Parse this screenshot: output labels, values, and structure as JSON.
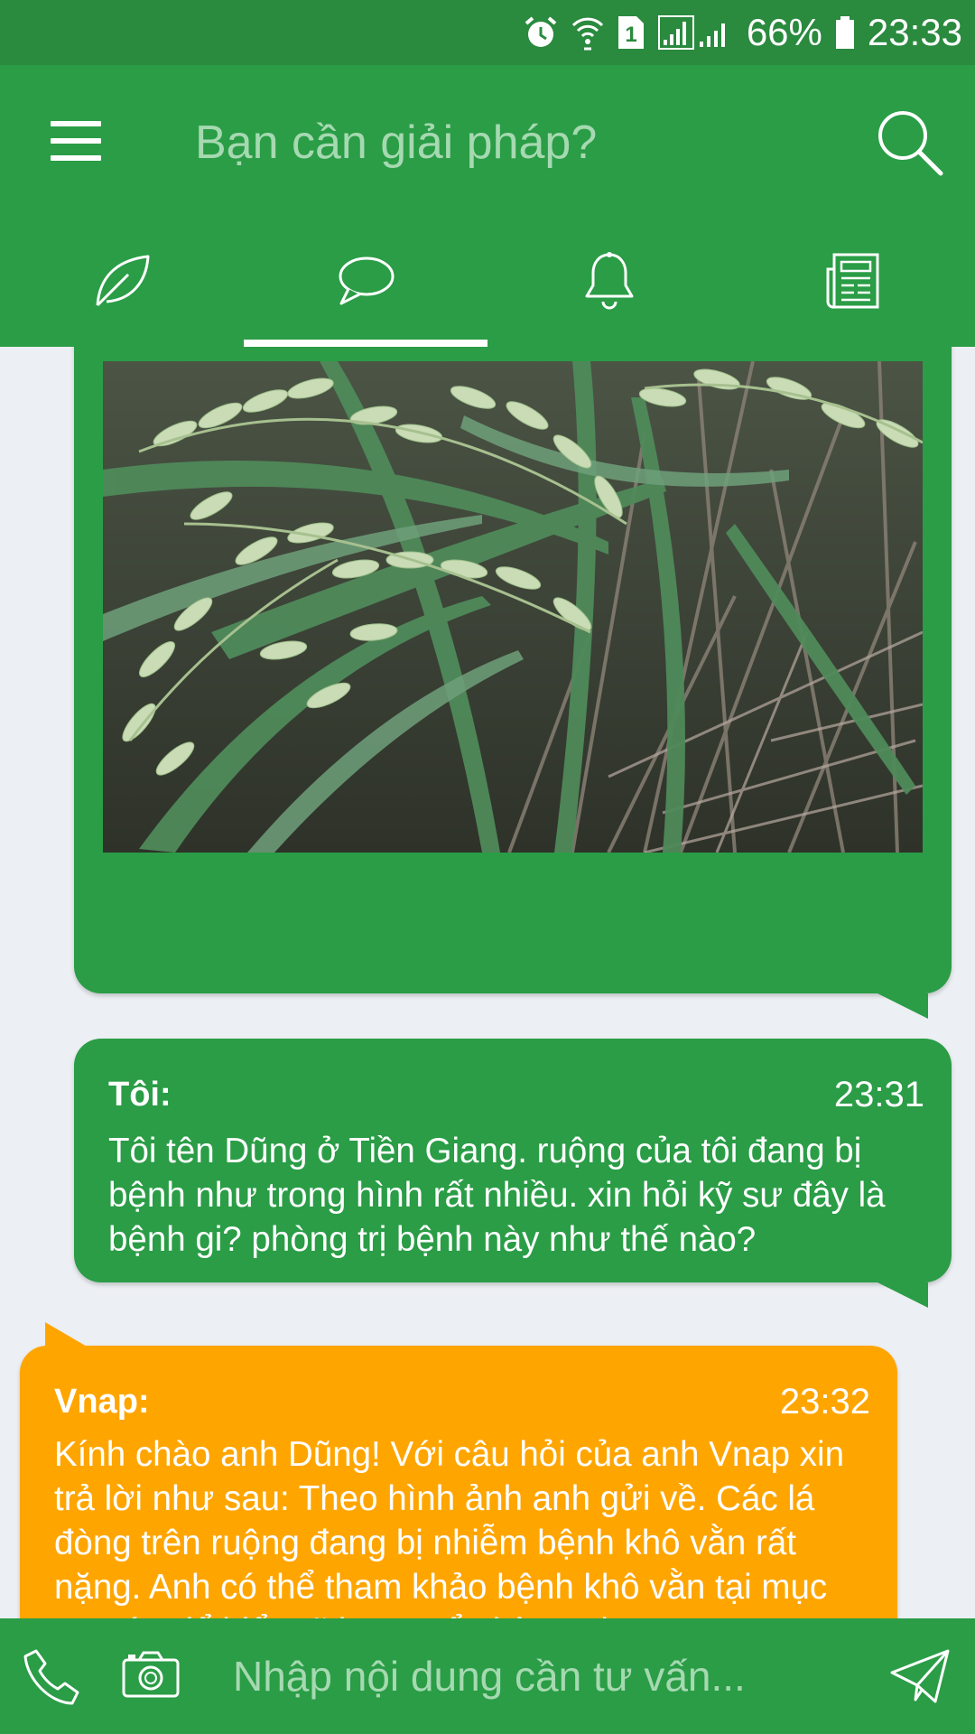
{
  "status_bar": {
    "sim_slot": "1",
    "battery": "66%",
    "time": "23:33",
    "icons": [
      "alarm-icon",
      "wifi-icon",
      "sim-icon",
      "signal-icon",
      "battery-icon"
    ]
  },
  "header": {
    "search_placeholder": "Bạn cần giải pháp?",
    "menu_icon": "hamburger-menu-icon",
    "search_icon": "search-icon"
  },
  "tabs": [
    {
      "icon": "leaf-icon",
      "active": false
    },
    {
      "icon": "chat-bubble-icon",
      "active": true
    },
    {
      "icon": "bell-icon",
      "active": false
    },
    {
      "icon": "newspaper-icon",
      "active": false
    }
  ],
  "messages": [
    {
      "type": "image",
      "image_subject": "rice-plant-photo",
      "color": "#2a9d46"
    },
    {
      "sender": "Tôi:",
      "time": "23:31",
      "text": "Tôi tên Dũng ở Tiền Giang. ruộng của tôi đang bị bệnh như trong hình rất nhiều. xin hỏi kỹ sư đây là bệnh gi? phòng trị bệnh này như thế nào?",
      "color": "#2a9d46"
    },
    {
      "sender": "Vnap:",
      "time": "23:32",
      "text": "Kính chào anh Dũng! Với câu hỏi của anh Vnap xin trả lời như sau: Theo hình ảnh anh gửi về. Các lá đòng trên ruộng đang bị nhiễm bệnh khô vằn rất nặng. Anh có thể tham khảo bệnh khô vằn tại mục tra cứu để hiểu rõ hơn. Để phòng trị",
      "color": "#ffa500"
    }
  ],
  "composer": {
    "placeholder": "Nhập nội dung cần tư vấn...",
    "call_icon": "phone-icon",
    "camera_icon": "camera-icon",
    "send_icon": "send-icon"
  },
  "colors": {
    "primary": "#2a9d46",
    "status_bar": "#2a8a3e",
    "reply_bubble": "#ffa500",
    "background": "#eceff3"
  }
}
